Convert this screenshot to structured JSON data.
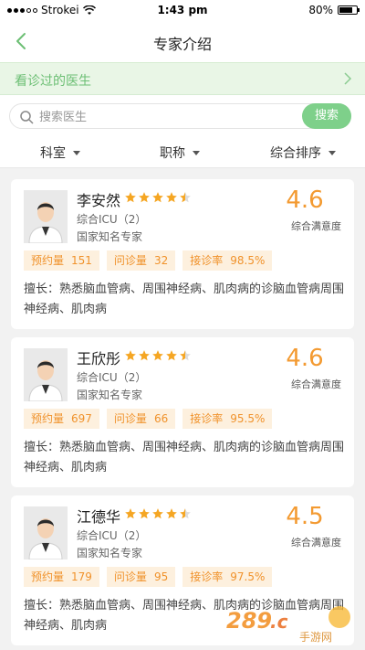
{
  "status_bar": {
    "carrier": "Strokei",
    "time": "1:43 pm",
    "battery_pct": "80%",
    "battery_level": 0.8
  },
  "nav": {
    "title": "专家介绍",
    "back_icon": "chevron-left-icon"
  },
  "visited": {
    "label": "看诊过的医生",
    "arrow_icon": "chevron-right-icon"
  },
  "search": {
    "placeholder": "搜索医生",
    "button_label": "搜索",
    "icon": "search-icon"
  },
  "filters": [
    {
      "label": "科室",
      "icon": "caret-down-icon"
    },
    {
      "label": "职称",
      "icon": "caret-down-icon"
    },
    {
      "label": "综合排序",
      "icon": "caret-down-icon"
    }
  ],
  "doctors": [
    {
      "name": "李安然",
      "rating": 4.5,
      "dept": "综合ICU（2）",
      "title": "国家知名专家",
      "score": "4.6",
      "score_label": "综合满意度",
      "tags": [
        {
          "k": "预约量",
          "v": "151"
        },
        {
          "k": "问诊量",
          "v": "32"
        },
        {
          "k": "接诊率",
          "v": "98.5%"
        }
      ],
      "specialty": "擅长：熟悉脑血管病、周围神经病、肌肉病的诊脑血管病周围神经病、肌肉病"
    },
    {
      "name": "王欣彤",
      "rating": 4.5,
      "dept": "综合ICU（2）",
      "title": "国家知名专家",
      "score": "4.6",
      "score_label": "综合满意度",
      "tags": [
        {
          "k": "预约量",
          "v": "697"
        },
        {
          "k": "问诊量",
          "v": "66"
        },
        {
          "k": "接诊率",
          "v": "95.5%"
        }
      ],
      "specialty": "擅长：熟悉脑血管病、周围神经病、肌肉病的诊脑血管病周围神经病、肌肉病"
    },
    {
      "name": "江德华",
      "rating": 4.5,
      "dept": "综合ICU（2）",
      "title": "国家知名专家",
      "score": "4.5",
      "score_label": "综合满意度",
      "tags": [
        {
          "k": "预约量",
          "v": "179"
        },
        {
          "k": "问诊量",
          "v": "95"
        },
        {
          "k": "接诊率",
          "v": "97.5%"
        }
      ],
      "specialty": "擅长：熟悉脑血管病、周围神经病、肌肉病的诊脑血管病周围神经病、肌肉病"
    }
  ],
  "watermark": {
    "text": "289.com",
    "subtext": "手游网"
  },
  "colors": {
    "accent_green": "#7ed08a",
    "banner_green_text": "#6cbf74",
    "score_orange": "#f39a31",
    "tag_bg": "#fdf0de",
    "star": "#f5a623"
  }
}
